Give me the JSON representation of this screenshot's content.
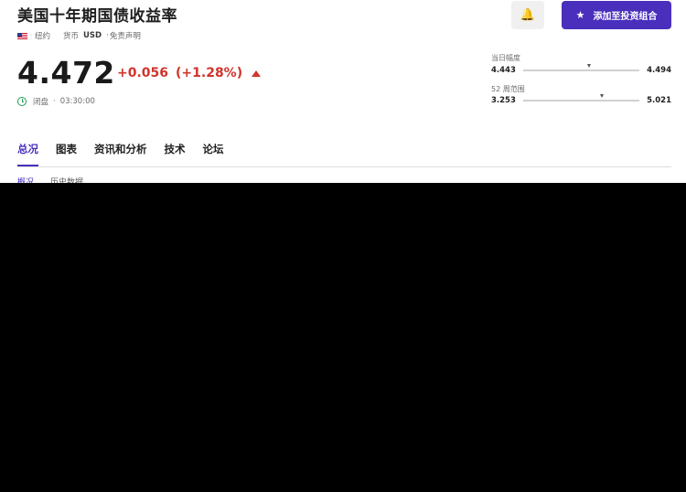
{
  "instrument": {
    "title": "美国十年期国债收益率",
    "location": "纽约",
    "currency_label": "货币",
    "currency_code": "USD",
    "disclaimer": "免责声明"
  },
  "quote": {
    "price": "4.472",
    "change": "+0.056",
    "change_pct": "(+1.28%)",
    "direction": "up",
    "status": "闭盘",
    "time": "03:30:00"
  },
  "actions": {
    "watchlist_label": "添加至投资组合"
  },
  "ranges": {
    "day": {
      "label": "当日幅度",
      "low": "4.443",
      "high": "4.494",
      "current_fraction": 0.57
    },
    "week52": {
      "label": "52 周范围",
      "low": "3.253",
      "high": "5.021",
      "current_fraction": 0.68
    }
  },
  "tabs": [
    "总况",
    "图表",
    "资讯和分析",
    "技术",
    "论坛"
  ],
  "subtabs": [
    "概况",
    "历史数据"
  ],
  "colors": {
    "accent": "#4a2fbd",
    "negative_up": "#d0342c",
    "market_closed": "#1f9d55"
  }
}
